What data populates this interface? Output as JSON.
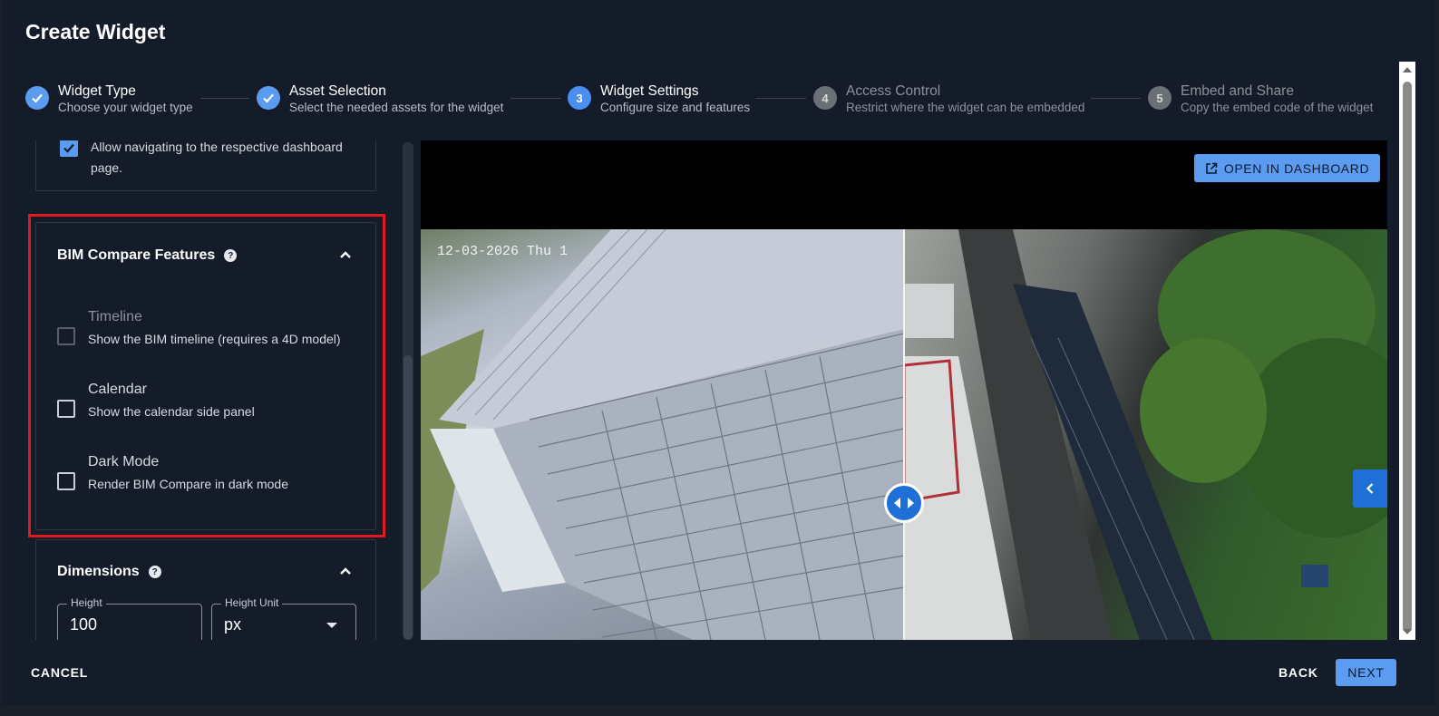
{
  "dialog": {
    "title": "Create Widget"
  },
  "steps": [
    {
      "number": "1",
      "title": "Widget Type",
      "subtitle": "Choose your widget type",
      "state": "done"
    },
    {
      "number": "2",
      "title": "Asset Selection",
      "subtitle": "Select the needed assets for the widget",
      "state": "done"
    },
    {
      "number": "3",
      "title": "Widget Settings",
      "subtitle": "Configure size and features",
      "state": "active"
    },
    {
      "number": "4",
      "title": "Access Control",
      "subtitle": "Restrict where the widget can be embedded",
      "state": "pending"
    },
    {
      "number": "5",
      "title": "Embed and Share",
      "subtitle": "Copy the embed code of the widget",
      "state": "pending"
    }
  ],
  "navigation_option": {
    "label": "Allow navigating to the respective dashboard page.",
    "checked": true
  },
  "bim_features": {
    "title": "BIM Compare Features",
    "help_icon": "help-icon",
    "options": [
      {
        "label": "Timeline",
        "description": "Show the BIM timeline (requires a 4D model)",
        "checked": false,
        "disabled": true
      },
      {
        "label": "Calendar",
        "description": "Show the calendar side panel",
        "checked": false,
        "disabled": false
      },
      {
        "label": "Dark Mode",
        "description": "Render BIM Compare in dark mode",
        "checked": false,
        "disabled": false
      }
    ]
  },
  "dimensions": {
    "title": "Dimensions",
    "height_label": "Height",
    "height_value": "100",
    "unit_label": "Height Unit",
    "unit_value": "px"
  },
  "preview": {
    "timestamp": "12-03-2026 Thu 1",
    "open_button": "OPEN IN DASHBOARD",
    "compare_handle_icon": "compare-arrows-icon",
    "side_button_icon": "chevron-left-icon"
  },
  "footer": {
    "cancel": "CANCEL",
    "back": "BACK",
    "next": "NEXT"
  },
  "colors": {
    "accent": "#5b9cf0",
    "highlight": "#e0191f",
    "background": "#141b29"
  }
}
